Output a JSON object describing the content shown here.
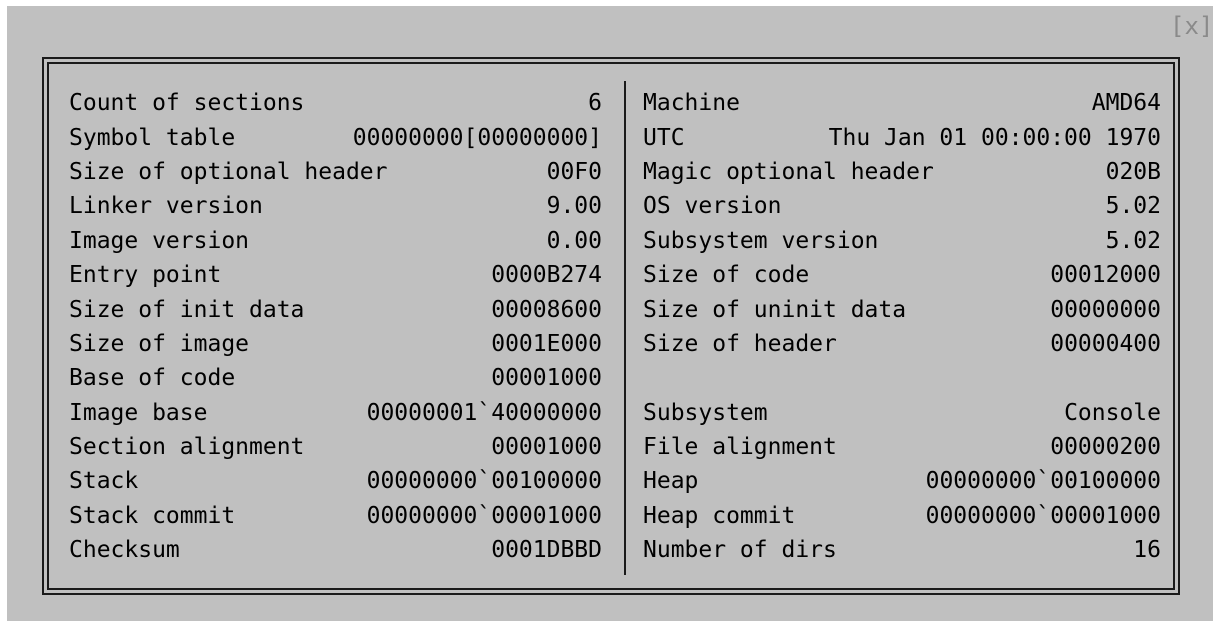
{
  "close_label": "[x]",
  "left_rows": [
    {
      "label": "Count of sections",
      "value": "6"
    },
    {
      "label": "Symbol table",
      "value": "00000000[00000000]"
    },
    {
      "label": "Size of optional header",
      "value": "00F0"
    },
    {
      "label": "Linker version",
      "value": "9.00"
    },
    {
      "label": "Image version",
      "value": "0.00"
    },
    {
      "label": "Entry point",
      "value": "0000B274"
    },
    {
      "label": "Size of init data",
      "value": "00008600"
    },
    {
      "label": "Size of image",
      "value": "0001E000"
    },
    {
      "label": "Base of code",
      "value": "00001000"
    },
    {
      "label": "Image base",
      "value": "00000001`40000000"
    },
    {
      "label": "Section alignment",
      "value": "00001000"
    },
    {
      "label": "Stack",
      "value": "00000000`00100000"
    },
    {
      "label": "Stack commit",
      "value": "00000000`00001000"
    },
    {
      "label": "Checksum",
      "value": "0001DBBD"
    }
  ],
  "right_rows": [
    {
      "label": "Machine",
      "value": "AMD64"
    },
    {
      "label": "UTC",
      "value": "Thu Jan 01 00:00:00 1970"
    },
    {
      "label": "Magic optional header",
      "value": "020B"
    },
    {
      "label": "OS version",
      "value": "5.02"
    },
    {
      "label": "Subsystem version",
      "value": "5.02"
    },
    {
      "label": "Size of code",
      "value": "00012000"
    },
    {
      "label": "Size of uninit data",
      "value": "00000000"
    },
    {
      "label": "Size of header",
      "value": "00000400"
    },
    {
      "label": "",
      "value": ""
    },
    {
      "label": "Subsystem",
      "value": "Console"
    },
    {
      "label": "File alignment",
      "value": "00000200"
    },
    {
      "label": "Heap",
      "value": "00000000`00100000"
    },
    {
      "label": "Heap commit",
      "value": "00000000`00001000"
    },
    {
      "label": "Number of dirs",
      "value": "16"
    }
  ]
}
